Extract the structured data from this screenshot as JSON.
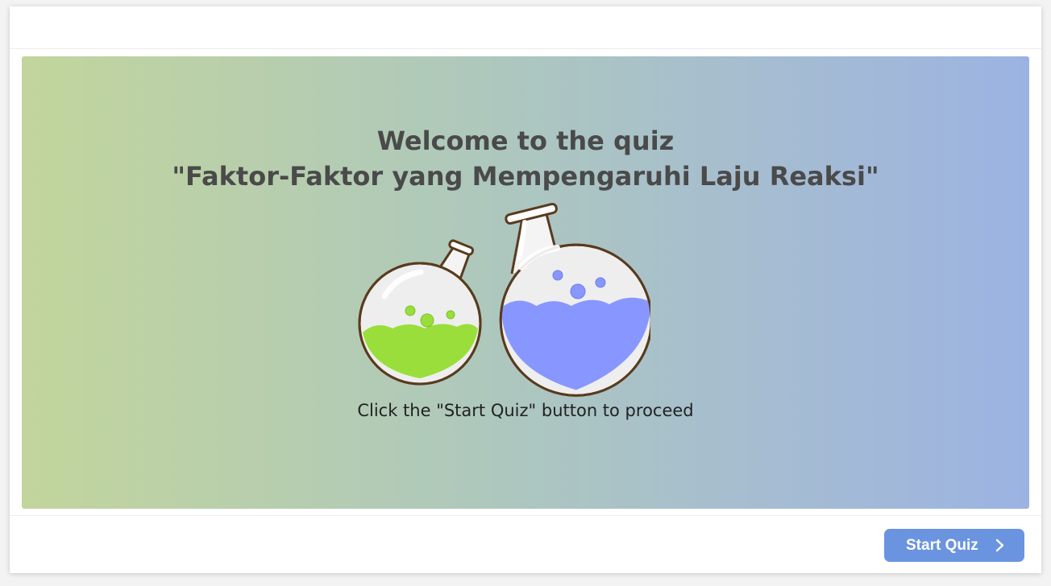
{
  "quiz": {
    "title_line1": "Welcome to the quiz",
    "title_line2": "\"Faktor-Faktor yang Mempengaruhi Laju Reaksi\"",
    "hint": "Click the \"Start Quiz\" button to proceed",
    "illustration_icon": "chemistry-flasks-icon"
  },
  "footer": {
    "start_label": "Start Quiz",
    "start_icon": "chevron-right-icon"
  },
  "colors": {
    "gradient_start": "#c2d59c",
    "gradient_end": "#9cb3e2",
    "button": "#6a94e0",
    "title_text": "#4a4a4a",
    "flask_green_liquid": "#9ade3b",
    "flask_blue_liquid": "#8896ff"
  }
}
